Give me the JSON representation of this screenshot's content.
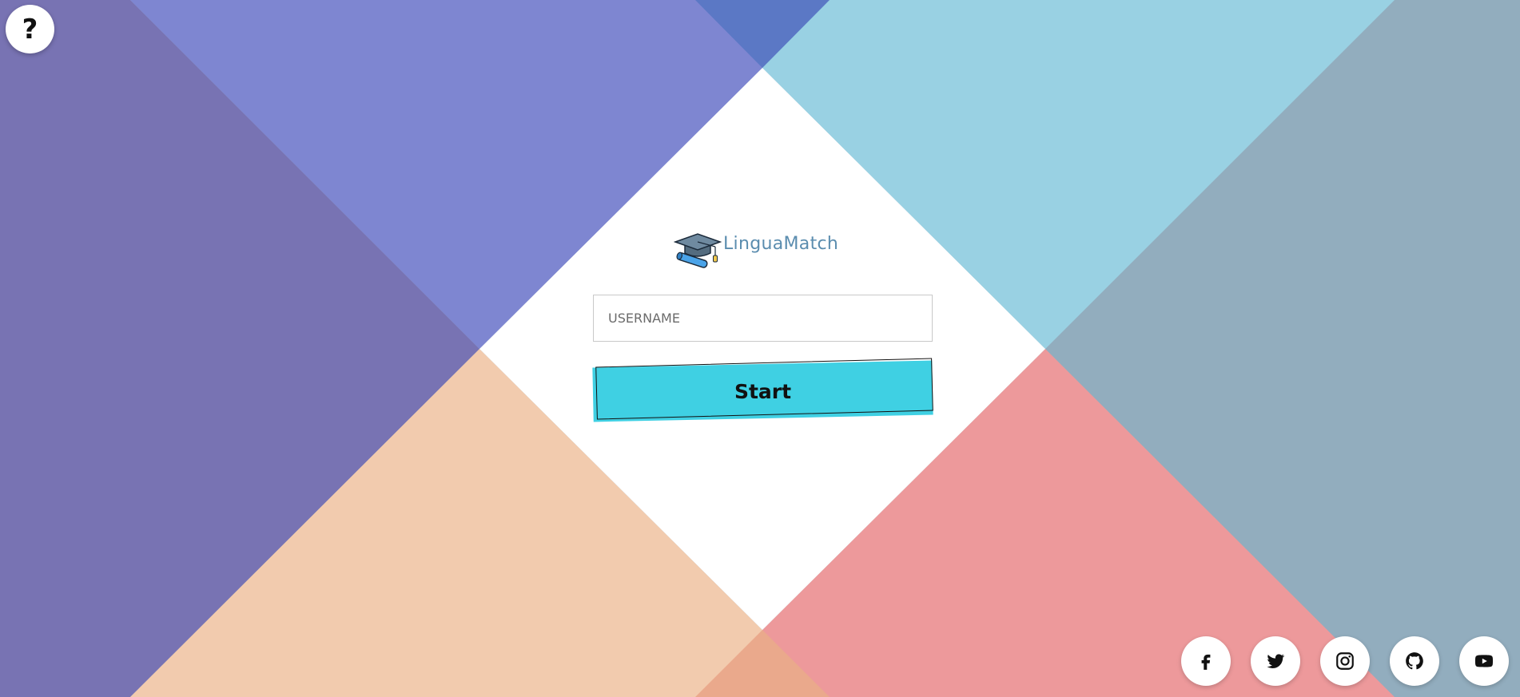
{
  "app": {
    "name": "LinguaMatch"
  },
  "help": {
    "label": "?"
  },
  "form": {
    "username_placeholder": "USERNAME",
    "username_value": "",
    "start_label": "Start"
  },
  "social": [
    {
      "icon": "facebook-icon"
    },
    {
      "icon": "twitter-icon"
    },
    {
      "icon": "instagram-icon"
    },
    {
      "icon": "github-icon"
    },
    {
      "icon": "youtube-icon"
    }
  ],
  "colors": {
    "accent": "#3fd0e3",
    "logo_text": "#5b8daf",
    "bg_left": "#7873b3",
    "bg_top_left": "#7e86d1",
    "bg_top_mid": "#5b78c5",
    "bg_top_right": "#99d1e3",
    "bg_right": "#92adbe",
    "bg_bottom_left": "#f2cbae",
    "bg_bottom_right": "#ed999b",
    "bg_bottom_mid": "#eaa98c"
  }
}
